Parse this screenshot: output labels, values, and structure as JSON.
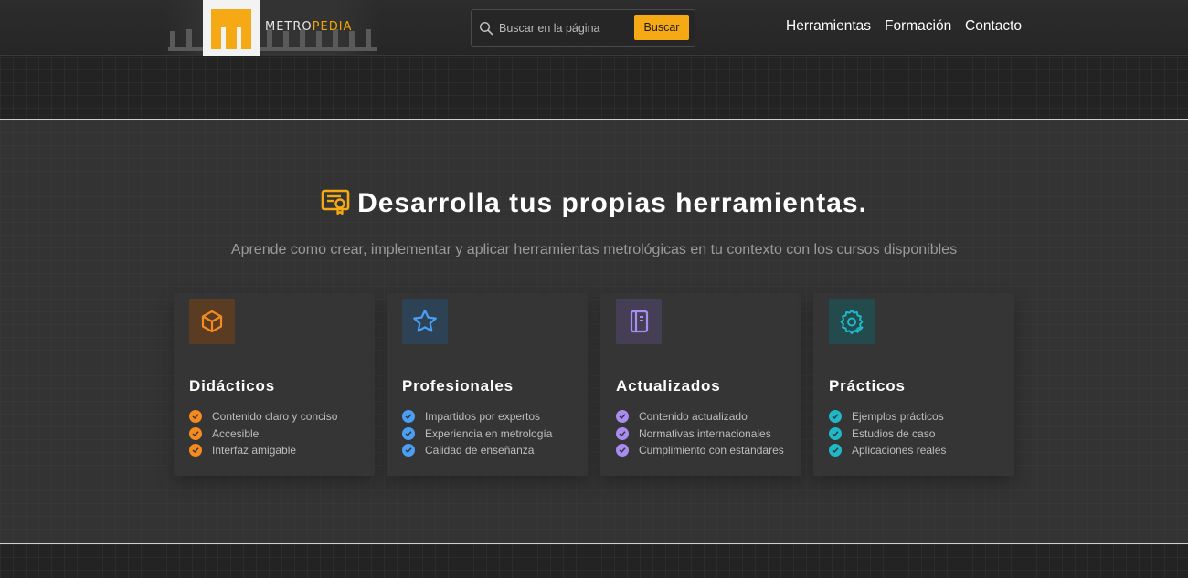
{
  "header": {
    "logo": {
      "text_a": "METRO",
      "text_b": "PEDIA"
    },
    "search": {
      "placeholder": "Buscar en la página",
      "button_label": "Buscar"
    },
    "nav": [
      "Herramientas",
      "Formación",
      "Contacto"
    ]
  },
  "hero": {
    "title": "Desarrolla tus propias herramientas.",
    "subtitle": "Aprende como crear, implementar y aplicar herramientas metrológicas en tu contexto con los cursos disponibles"
  },
  "cards": [
    {
      "title": "Didácticos",
      "icon": "cube-icon",
      "color": "#f58a1f",
      "bg": "#5a3c23",
      "items": [
        "Contenido claro y conciso",
        "Accesible",
        "Interfaz amigable"
      ]
    },
    {
      "title": "Profesionales",
      "icon": "star-icon",
      "color": "#4a9ff5",
      "bg": "#2e4256",
      "items": [
        "Impartidos por expertos",
        "Experiencia en metrología",
        "Calidad de enseñanza"
      ]
    },
    {
      "title": "Actualizados",
      "icon": "notebook-icon",
      "color": "#a98cf0",
      "bg": "#453f55",
      "items": [
        "Contenido actualizado",
        "Normativas internacionales",
        "Cumplimiento con estándares"
      ]
    },
    {
      "title": "Prácticos",
      "icon": "gear-check-icon",
      "color": "#1fb8c8",
      "bg": "#234a4d",
      "items": [
        "Ejemplos prácticos",
        "Estudios de caso",
        "Aplicaciones reales"
      ]
    }
  ],
  "colors": {
    "accent": "#f5a915",
    "title_icon": "#f5a915"
  }
}
